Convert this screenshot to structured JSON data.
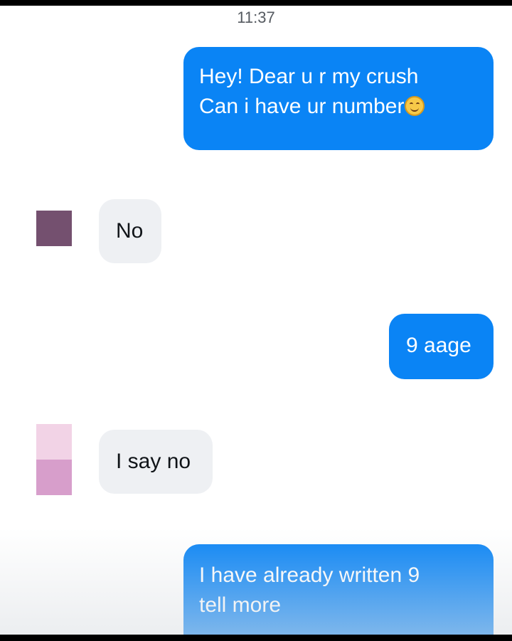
{
  "chat": {
    "timestamp": "11:37",
    "messages": [
      {
        "direction": "outgoing",
        "lines": [
          "Hey! Dear u r my crush",
          "Can i have ur number"
        ],
        "emoji": "smiling-face-emoji"
      },
      {
        "direction": "incoming",
        "text": "No"
      },
      {
        "direction": "outgoing",
        "text": "9 aage"
      },
      {
        "direction": "incoming",
        "text": "I say no"
      },
      {
        "direction": "outgoing",
        "lines": [
          "I have already written 9",
          "tell more"
        ]
      }
    ]
  },
  "colors": {
    "outgoing_bubble": "#0a84f5",
    "incoming_bubble": "#eef0f3",
    "avatar_1": "#74506f",
    "avatar_2_top": "#f2d3e6",
    "avatar_2_bottom": "#d79ecb"
  }
}
